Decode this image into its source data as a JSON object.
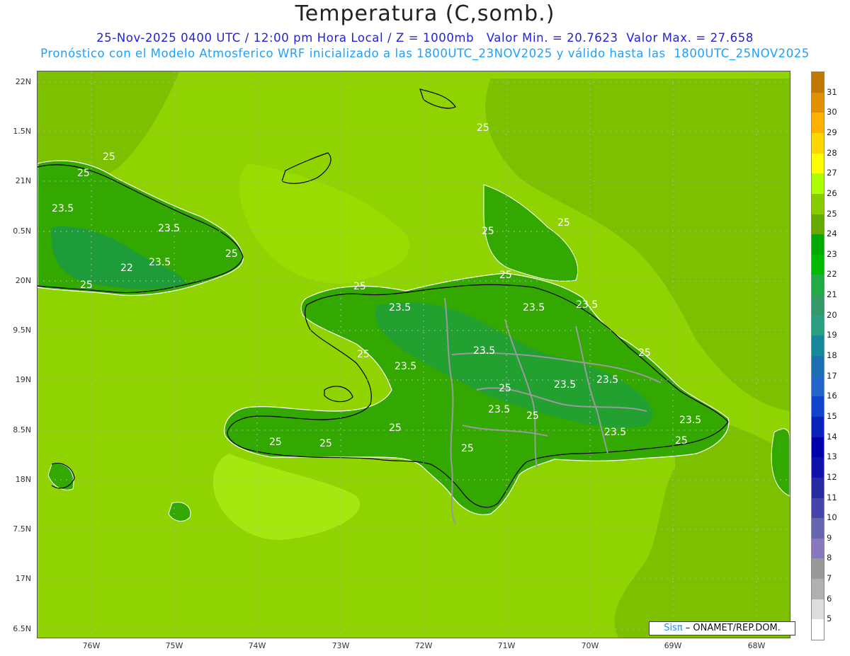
{
  "header": {
    "title": "Temperatura (C,somb.)",
    "subtitle_line1": "25-Nov-2025 0400 UTC / 12:00 pm Hora Local / Z = 1000mb   Valor Min. = 20.7623  Valor Max. = 27.658",
    "subtitle_line2": "Pronóstico con el Modelo Atmosferico WRF inicializado a las 1800UTC_23NOV2025 y válido hasta las  1800UTC_25NOV2025"
  },
  "axes": {
    "y_ticks": [
      "22N",
      "1.5N",
      "21N",
      "0.5N",
      "20N",
      "9.5N",
      "19N",
      "8.5N",
      "18N",
      "7.5N",
      "17N",
      "6.5N"
    ],
    "x_ticks": [
      "76W",
      "75W",
      "74W",
      "73W",
      "72W",
      "71W",
      "70W",
      "69W",
      "68W"
    ]
  },
  "contour_labels": [
    "25",
    "25",
    "25",
    "23.5",
    "23.5",
    "22",
    "23.5",
    "25",
    "25",
    "25",
    "25",
    "25",
    "23.5",
    "23.5",
    "23.5",
    "25",
    "25",
    "23.5",
    "23.5",
    "25",
    "23.5",
    "25",
    "23.5",
    "25",
    "23.5",
    "23.5",
    "25",
    "25",
    "25",
    "25",
    "23.5",
    "25"
  ],
  "colorbar": {
    "labels": [
      "31",
      "30",
      "29",
      "28",
      "27",
      "26",
      "25",
      "24",
      "23",
      "22",
      "21",
      "20",
      "19",
      "18",
      "17",
      "16",
      "15",
      "14",
      "13",
      "12",
      "11",
      "10",
      "9",
      "8",
      "7",
      "6",
      "5"
    ],
    "colors": [
      "#c07800",
      "#e09000",
      "#ffb000",
      "#ffd700",
      "#ffff00",
      "#aaff00",
      "#88cc00",
      "#66aa00",
      "#00aa00",
      "#00bb00",
      "#22aa44",
      "#339966",
      "#2aa080",
      "#158899",
      "#1a70b0",
      "#2266cc",
      "#1144cc",
      "#0a22bb",
      "#0000aa",
      "#1010aa",
      "#2a2aa0",
      "#4444aa",
      "#6666b0",
      "#8877bb",
      "#999999",
      "#b0b0b0",
      "#dddddd",
      "#ffffff"
    ]
  },
  "credit": {
    "logo": "Sisπ",
    "text": " – ONAMET/REP.DOM."
  }
}
